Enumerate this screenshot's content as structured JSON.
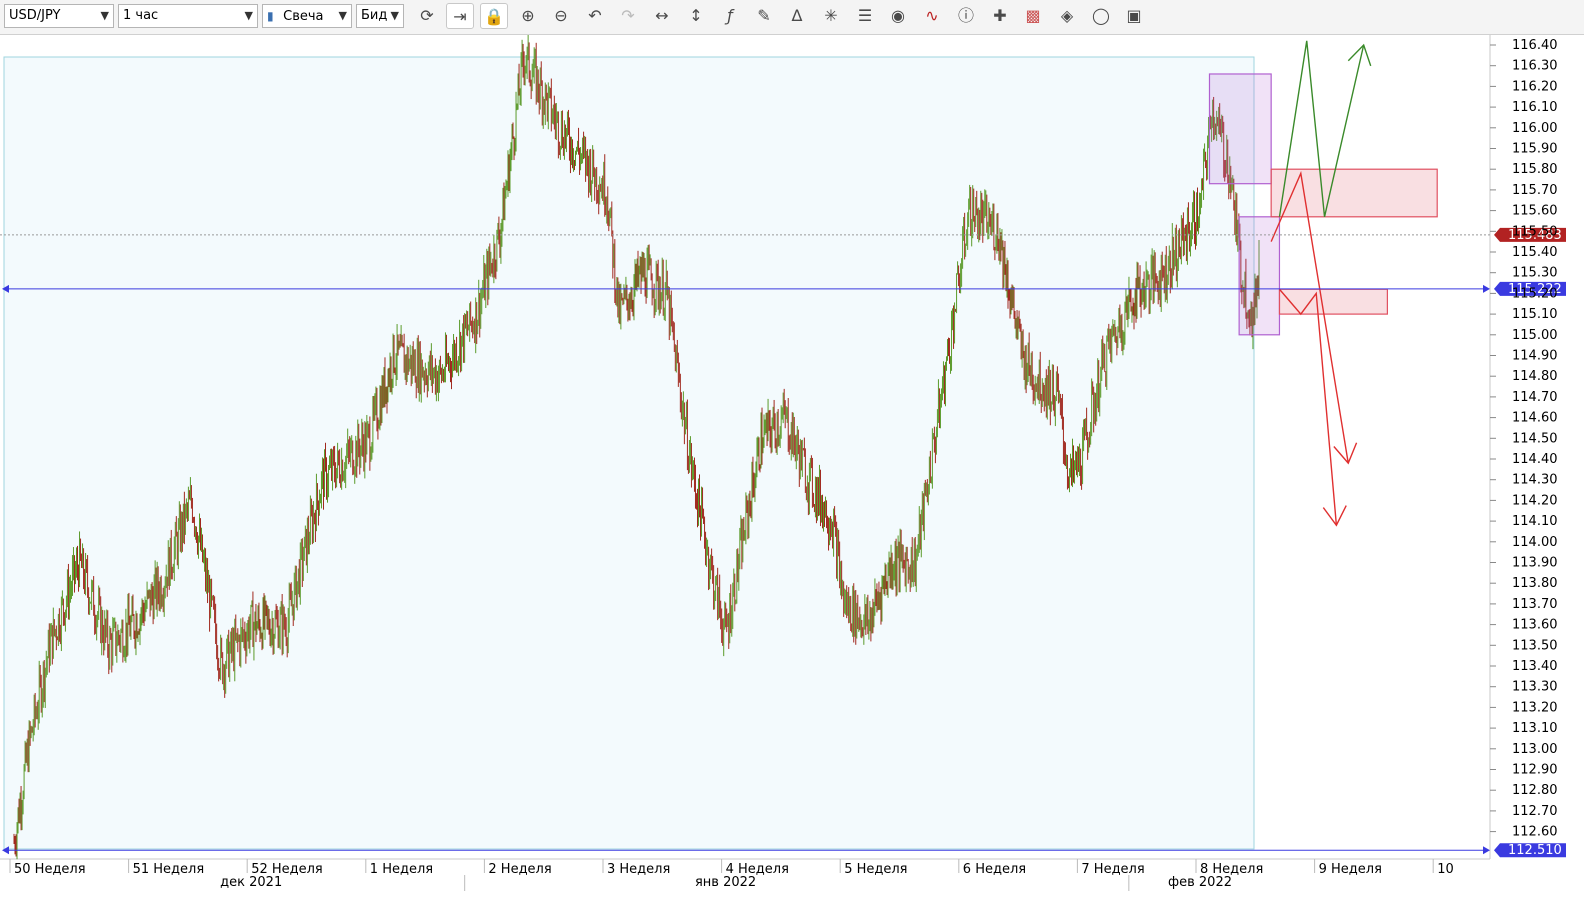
{
  "toolbar": {
    "symbol": "USD/JPY",
    "timeframe": "1 час",
    "chart_type": "Свеча",
    "price_side": "Бид"
  },
  "chart_data": {
    "type": "candlestick",
    "instrument": "USD/JPY",
    "timeframe": "1 час",
    "y_ticks": [
      116.4,
      116.3,
      116.2,
      116.1,
      116.0,
      115.9,
      115.8,
      115.7,
      115.6,
      115.5,
      115.4,
      115.3,
      115.2,
      115.1,
      115.0,
      114.9,
      114.8,
      114.7,
      114.6,
      114.5,
      114.4,
      114.3,
      114.2,
      114.1,
      114.0,
      113.9,
      113.8,
      113.7,
      113.6,
      113.5,
      113.4,
      113.3,
      113.2,
      113.1,
      113.0,
      112.9,
      112.8,
      112.7,
      112.6
    ],
    "ylim": [
      112.5,
      116.43
    ],
    "price_markers": [
      {
        "label": "115.483",
        "value": 115.483,
        "color": "#b22222",
        "style": "dotted"
      },
      {
        "label": "115.222",
        "value": 115.222,
        "color": "#3a3ae0",
        "style": "solid"
      },
      {
        "label": "112.510",
        "value": 112.51,
        "color": "#3a3ae0",
        "style": "solid"
      }
    ],
    "week_labels": [
      "50 Неделя",
      "51 Неделя",
      "52 Неделя",
      "1 Неделя",
      "2 Неделя",
      "3 Неделя",
      "4 Неделя",
      "5 Неделя",
      "6 Неделя",
      "7 Неделя",
      "8 Неделя",
      "9 Неделя",
      "10"
    ],
    "month_labels": [
      "дек 2021",
      "янв 2022",
      "фев 2022"
    ],
    "price_path": [
      {
        "week": 0,
        "price": 112.55
      },
      {
        "week": 0.12,
        "price": 113.0
      },
      {
        "week": 0.3,
        "price": 113.5
      },
      {
        "week": 0.55,
        "price": 113.9
      },
      {
        "week": 0.8,
        "price": 113.5
      },
      {
        "week": 1.0,
        "price": 113.6
      },
      {
        "week": 1.25,
        "price": 113.8
      },
      {
        "week": 1.5,
        "price": 114.2
      },
      {
        "week": 1.75,
        "price": 113.4
      },
      {
        "week": 2.0,
        "price": 113.6
      },
      {
        "week": 2.3,
        "price": 113.6
      },
      {
        "week": 2.6,
        "price": 114.3
      },
      {
        "week": 3.0,
        "price": 114.5
      },
      {
        "week": 3.2,
        "price": 114.9
      },
      {
        "week": 3.6,
        "price": 114.8
      },
      {
        "week": 3.9,
        "price": 115.1
      },
      {
        "week": 4.1,
        "price": 115.5
      },
      {
        "week": 4.3,
        "price": 116.35
      },
      {
        "week": 4.6,
        "price": 116.0
      },
      {
        "week": 5.0,
        "price": 115.7
      },
      {
        "week": 5.1,
        "price": 115.1
      },
      {
        "week": 5.3,
        "price": 115.3
      },
      {
        "week": 5.5,
        "price": 115.2
      },
      {
        "week": 5.7,
        "price": 114.4
      },
      {
        "week": 5.9,
        "price": 113.8
      },
      {
        "week": 6.0,
        "price": 113.55
      },
      {
        "week": 6.3,
        "price": 114.5
      },
      {
        "week": 6.5,
        "price": 114.6
      },
      {
        "week": 6.7,
        "price": 114.3
      },
      {
        "week": 6.9,
        "price": 114.1
      },
      {
        "week": 7.0,
        "price": 113.7
      },
      {
        "week": 7.2,
        "price": 113.6
      },
      {
        "week": 7.4,
        "price": 113.9
      },
      {
        "week": 7.6,
        "price": 113.9
      },
      {
        "week": 7.9,
        "price": 115.0
      },
      {
        "week": 8.05,
        "price": 115.6
      },
      {
        "week": 8.3,
        "price": 115.5
      },
      {
        "week": 8.5,
        "price": 114.9
      },
      {
        "week": 8.6,
        "price": 114.8
      },
      {
        "week": 8.8,
        "price": 114.7
      },
      {
        "week": 8.9,
        "price": 114.3
      },
      {
        "week": 9.0,
        "price": 114.4
      },
      {
        "week": 9.2,
        "price": 114.9
      },
      {
        "week": 9.45,
        "price": 115.2
      },
      {
        "week": 9.7,
        "price": 115.3
      },
      {
        "week": 9.9,
        "price": 115.5
      },
      {
        "week": 10.0,
        "price": 115.6
      },
      {
        "week": 10.1,
        "price": 116.1
      },
      {
        "week": 10.25,
        "price": 115.8
      },
      {
        "week": 10.35,
        "price": 115.3
      },
      {
        "week": 10.45,
        "price": 115.05
      },
      {
        "week": 10.5,
        "price": 115.4
      }
    ],
    "rectangles": [
      {
        "name": "purple-box-upper",
        "x": [
          10.08,
          10.6
        ],
        "y": [
          115.73,
          116.26
        ],
        "color": "#b060d0"
      },
      {
        "name": "purple-box-lower",
        "x": [
          10.33,
          10.67
        ],
        "y": [
          115.0,
          115.57
        ],
        "color": "#b060d0"
      },
      {
        "name": "red-zone-upper",
        "x": [
          10.6,
          12.0
        ],
        "y": [
          115.57,
          115.8
        ],
        "color": "#e05060"
      },
      {
        "name": "red-zone-lower",
        "x": [
          10.67,
          11.58
        ],
        "y": [
          115.1,
          115.22
        ],
        "color": "#e05060"
      }
    ],
    "forecast_arrows": [
      {
        "name": "green-arrow",
        "color": "#3a8a2a",
        "points": [
          [
            10.67,
            115.57
          ],
          [
            10.9,
            116.42
          ],
          [
            11.05,
            115.57
          ],
          [
            11.38,
            116.4
          ]
        ]
      },
      {
        "name": "red-arrow-1",
        "color": "#e03030",
        "points": [
          [
            10.6,
            115.45
          ],
          [
            10.85,
            115.78
          ],
          [
            11.25,
            114.38
          ]
        ]
      },
      {
        "name": "red-arrow-2",
        "color": "#e03030",
        "points": [
          [
            10.67,
            115.22
          ],
          [
            10.85,
            115.1
          ],
          [
            10.98,
            115.2
          ],
          [
            11.15,
            114.08
          ]
        ]
      }
    ]
  }
}
